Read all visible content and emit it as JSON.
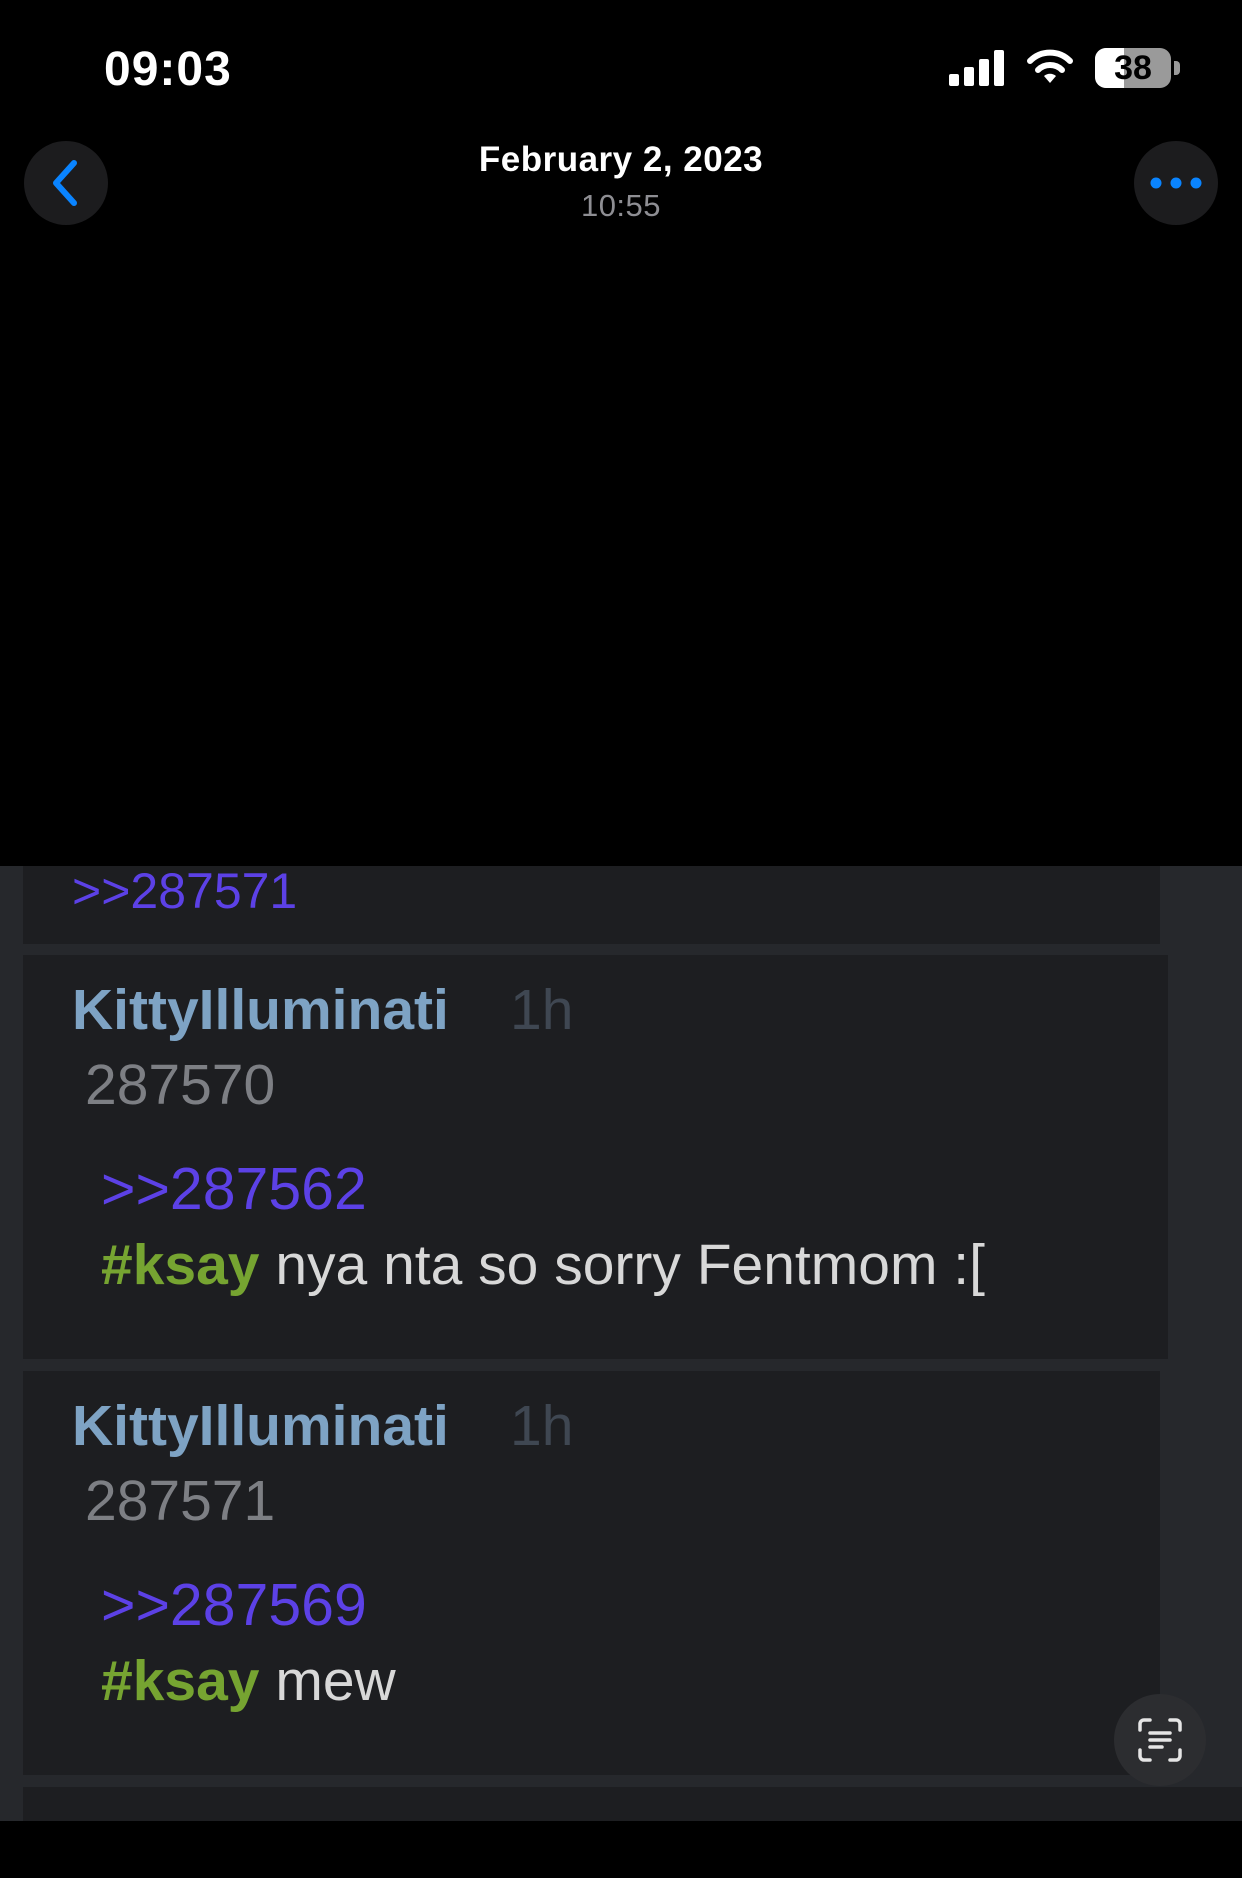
{
  "status_bar": {
    "time": "09:03",
    "battery_level": "38",
    "battery_fraction": 0.38,
    "icons": [
      "cellular-signal-icon",
      "wifi-icon",
      "battery-icon"
    ]
  },
  "nav": {
    "title": "February 2, 2023",
    "subtitle": "10:55",
    "back_icon": "chevron-left-icon",
    "more_icon": "ellipsis-icon",
    "accent_color": "#0a84ff"
  },
  "photo": {
    "top_quote": ">>287571",
    "posts": [
      {
        "author": "KittyIlluminati",
        "time": "1h",
        "post_number": "287570",
        "quote": ">>287562",
        "tag": "#ksay",
        "message": " nya nta so sorry Fentmom :["
      },
      {
        "author": "KittyIlluminati",
        "time": "1h",
        "post_number": "287571",
        "quote": ">>287569",
        "tag": "#ksay",
        "message": " mew"
      }
    ],
    "colors": {
      "author": "#7ea3c4",
      "quote": "#5c41e6",
      "tag": "#76a431",
      "card_bg": "#1d1e21"
    }
  },
  "live_text_button_icon": "live-text-icon"
}
